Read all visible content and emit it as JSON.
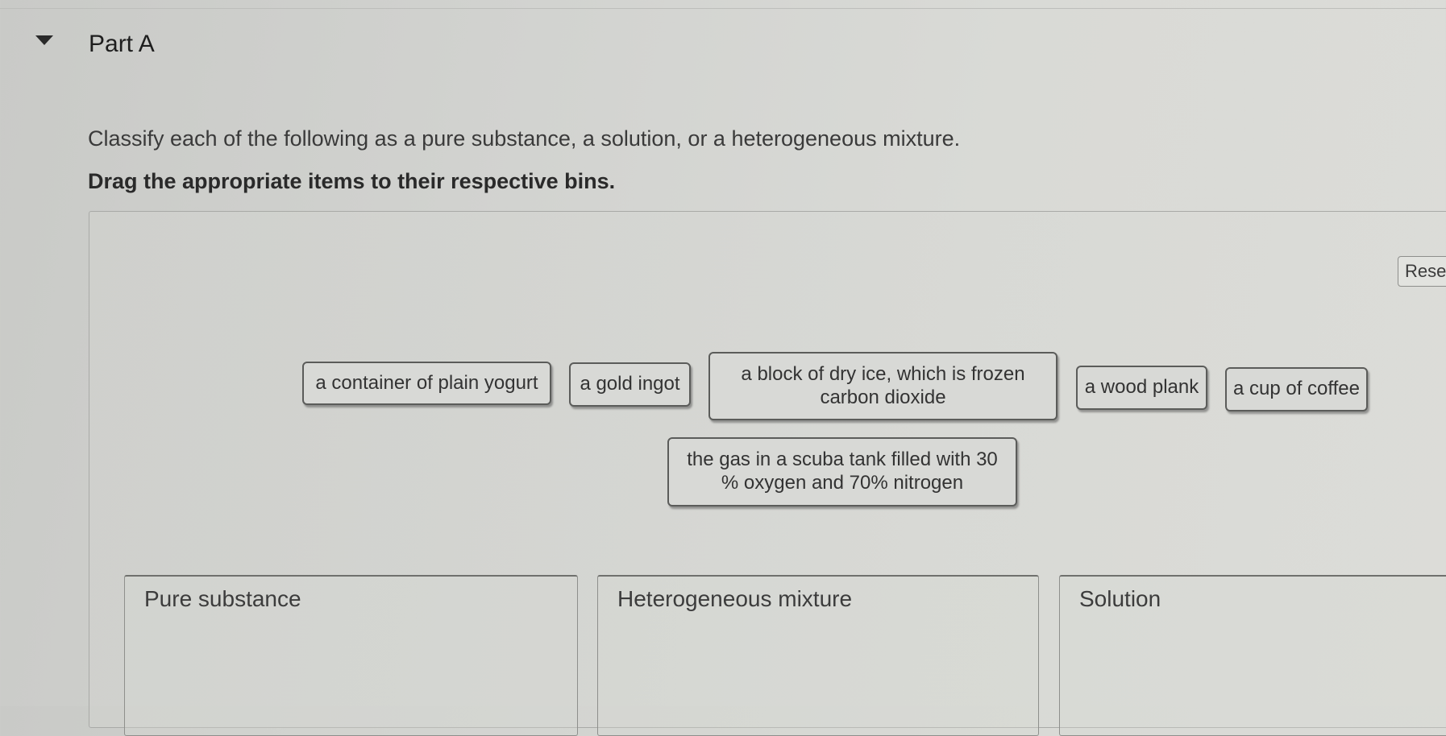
{
  "part": {
    "title": "Part A"
  },
  "question": {
    "prompt": "Classify each of the following as a pure substance, a solution, or a heterogeneous mixture.",
    "instruction": "Drag the appropriate items to their respective bins."
  },
  "controls": {
    "reset_label": "Rese"
  },
  "items": [
    "a container of plain yogurt",
    "a gold ingot",
    "a block of dry ice, which is frozen carbon dioxide",
    "a wood plank",
    "a cup of coffee",
    "the gas in a scuba tank filled with 30 % oxygen and 70% nitrogen"
  ],
  "bins": [
    "Pure substance",
    "Heterogeneous mixture",
    "Solution"
  ]
}
